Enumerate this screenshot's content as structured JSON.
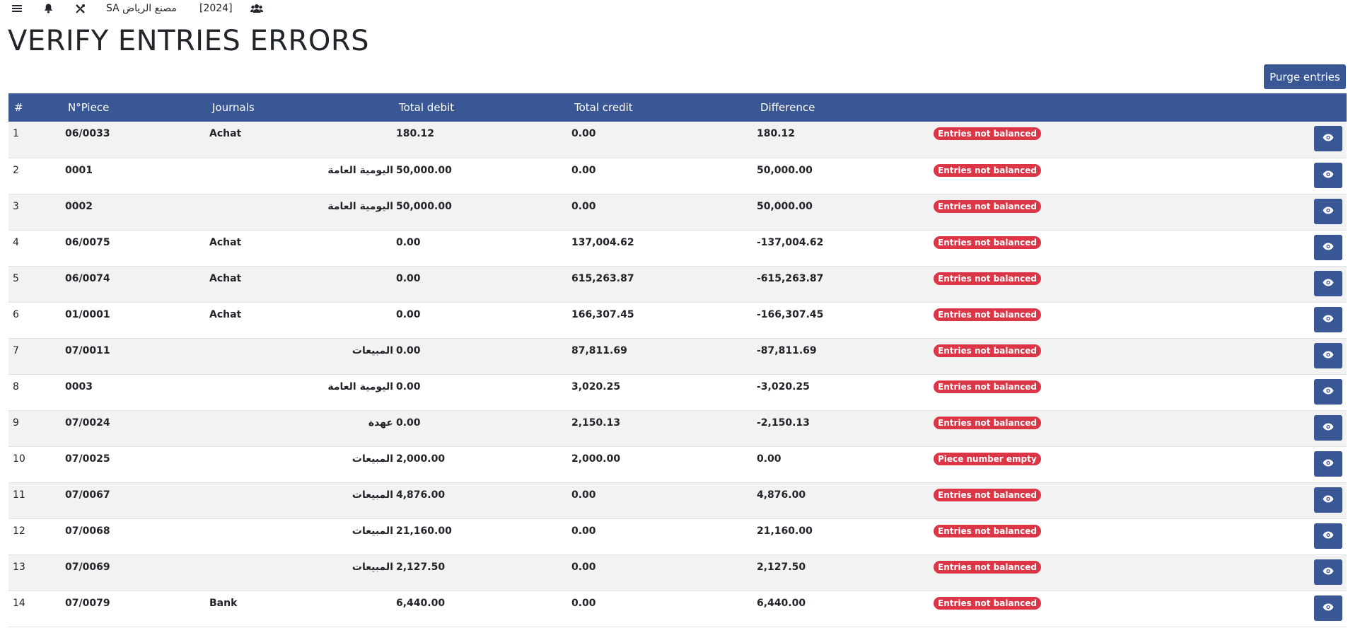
{
  "topbar": {
    "menu_icon": "hamburger-menu-icon",
    "bell_icon": "bell-icon",
    "tools_icon": "tools-icon",
    "company": "مصنع الرياض SA",
    "year": "[2024]",
    "users_icon": "users-icon"
  },
  "page": {
    "title": "VERIFY ENTRIES ERRORS",
    "purge_label": "Purge entries"
  },
  "colors": {
    "primary": "#3a5795",
    "danger": "#dc3545",
    "row_alt": "#f2f2f2"
  },
  "table": {
    "headers": [
      "#",
      "N°Piece",
      "Journals",
      "Total debit",
      "Total credit",
      "Difference",
      "",
      ""
    ],
    "rows": [
      {
        "idx": "1",
        "piece": "06/0033",
        "journal": "Achat",
        "debit": "180.12",
        "credit": "0.00",
        "diff": "180.12",
        "error": "Entries not balanced"
      },
      {
        "idx": "2",
        "piece": "0001",
        "journal": "اليومية العامة",
        "debit": "50,000.00",
        "credit": "0.00",
        "diff": "50,000.00",
        "error": "Entries not balanced"
      },
      {
        "idx": "3",
        "piece": "0002",
        "journal": "اليومية العامة",
        "debit": "50,000.00",
        "credit": "0.00",
        "diff": "50,000.00",
        "error": "Entries not balanced"
      },
      {
        "idx": "4",
        "piece": "06/0075",
        "journal": "Achat",
        "debit": "0.00",
        "credit": "137,004.62",
        "diff": "-137,004.62",
        "error": "Entries not balanced"
      },
      {
        "idx": "5",
        "piece": "06/0074",
        "journal": "Achat",
        "debit": "0.00",
        "credit": "615,263.87",
        "diff": "-615,263.87",
        "error": "Entries not balanced"
      },
      {
        "idx": "6",
        "piece": "01/0001",
        "journal": "Achat",
        "debit": "0.00",
        "credit": "166,307.45",
        "diff": "-166,307.45",
        "error": "Entries not balanced"
      },
      {
        "idx": "7",
        "piece": "07/0011",
        "journal": "المبيعات",
        "debit": "0.00",
        "credit": "87,811.69",
        "diff": "-87,811.69",
        "error": "Entries not balanced"
      },
      {
        "idx": "8",
        "piece": "0003",
        "journal": "اليومية العامة",
        "debit": "0.00",
        "credit": "3,020.25",
        "diff": "-3,020.25",
        "error": "Entries not balanced"
      },
      {
        "idx": "9",
        "piece": "07/0024",
        "journal": "عهدة",
        "debit": "0.00",
        "credit": "2,150.13",
        "diff": "-2,150.13",
        "error": "Entries not balanced"
      },
      {
        "idx": "10",
        "piece": "07/0025",
        "journal": "المبيعات",
        "debit": "2,000.00",
        "credit": "2,000.00",
        "diff": "0.00",
        "error": "Piece number empty"
      },
      {
        "idx": "11",
        "piece": "07/0067",
        "journal": "المبيعات",
        "debit": "4,876.00",
        "credit": "0.00",
        "diff": "4,876.00",
        "error": "Entries not balanced"
      },
      {
        "idx": "12",
        "piece": "07/0068",
        "journal": "المبيعات",
        "debit": "21,160.00",
        "credit": "0.00",
        "diff": "21,160.00",
        "error": "Entries not balanced"
      },
      {
        "idx": "13",
        "piece": "07/0069",
        "journal": "المبيعات",
        "debit": "2,127.50",
        "credit": "0.00",
        "diff": "2,127.50",
        "error": "Entries not balanced"
      },
      {
        "idx": "14",
        "piece": "07/0079",
        "journal": "Bank",
        "debit": "6,440.00",
        "credit": "0.00",
        "diff": "6,440.00",
        "error": "Entries not balanced"
      }
    ],
    "action_icon": "eye-icon"
  }
}
